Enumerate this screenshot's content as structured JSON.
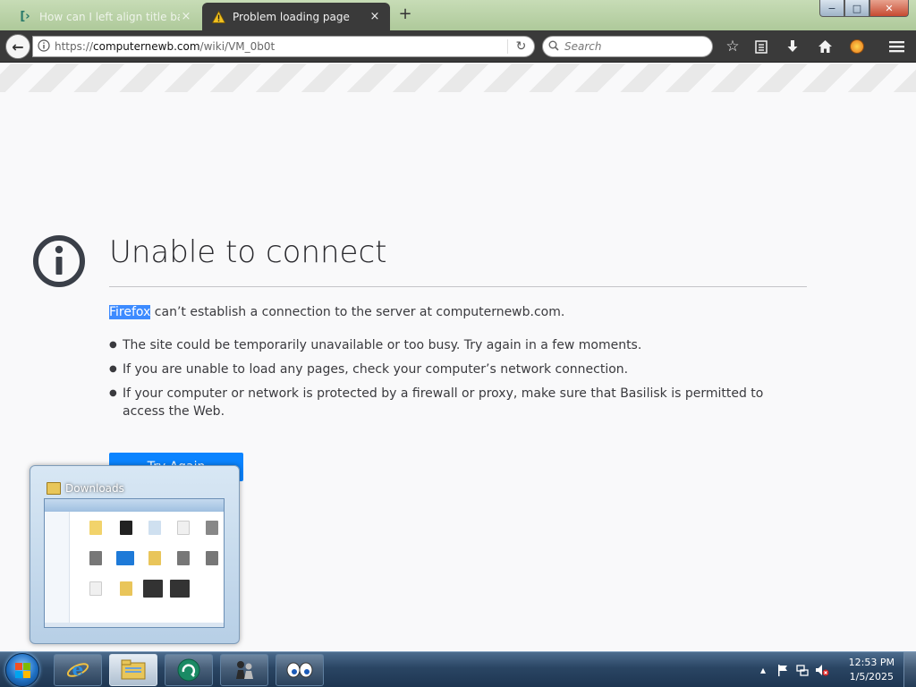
{
  "tabs": [
    {
      "title": "How can I left align title ba...",
      "close": "×",
      "active": false
    },
    {
      "title": "Problem loading page",
      "close": "×",
      "active": true
    }
  ],
  "new_tab": "+",
  "window_controls": {
    "minimize": "−",
    "maximize": "□",
    "close": "✕"
  },
  "navbar": {
    "back": "←",
    "url_prefix": "https://",
    "url_host": "computernewb.com",
    "url_path": "/wiki/VM_0b0t",
    "reload": "↻",
    "search_placeholder": "Search",
    "search_icon": "⌕"
  },
  "error_page": {
    "title": "Unable to connect",
    "desc_highlight": "Firefox",
    "desc_rest": " can’t establish a connection to the server at computernewb.com.",
    "bullets": [
      "The site could be temporarily unavailable or too busy. Try again in a few moments.",
      "If you are unable to load any pages, check your computer’s network connection.",
      "If your computer or network is protected by a firewall or proxy, make sure that Basilisk is permitted to access the Web."
    ],
    "try_again": "Try Again"
  },
  "preview": {
    "title": "Downloads"
  },
  "taskbar": {
    "clock_time": "12:53 PM",
    "clock_date": "1/5/2025",
    "tray_arrow": "▴"
  },
  "colors": {
    "accent": "#0a84ff",
    "selection": "#3d8bff",
    "toolbar": "#3a3a3a",
    "tabstrip": "#b7d0a5"
  },
  "icons": {
    "bookmark": "star-icon",
    "reader": "clipboard-icon",
    "download": "download-icon",
    "home": "home-icon",
    "menu": "hamburger-icon"
  }
}
